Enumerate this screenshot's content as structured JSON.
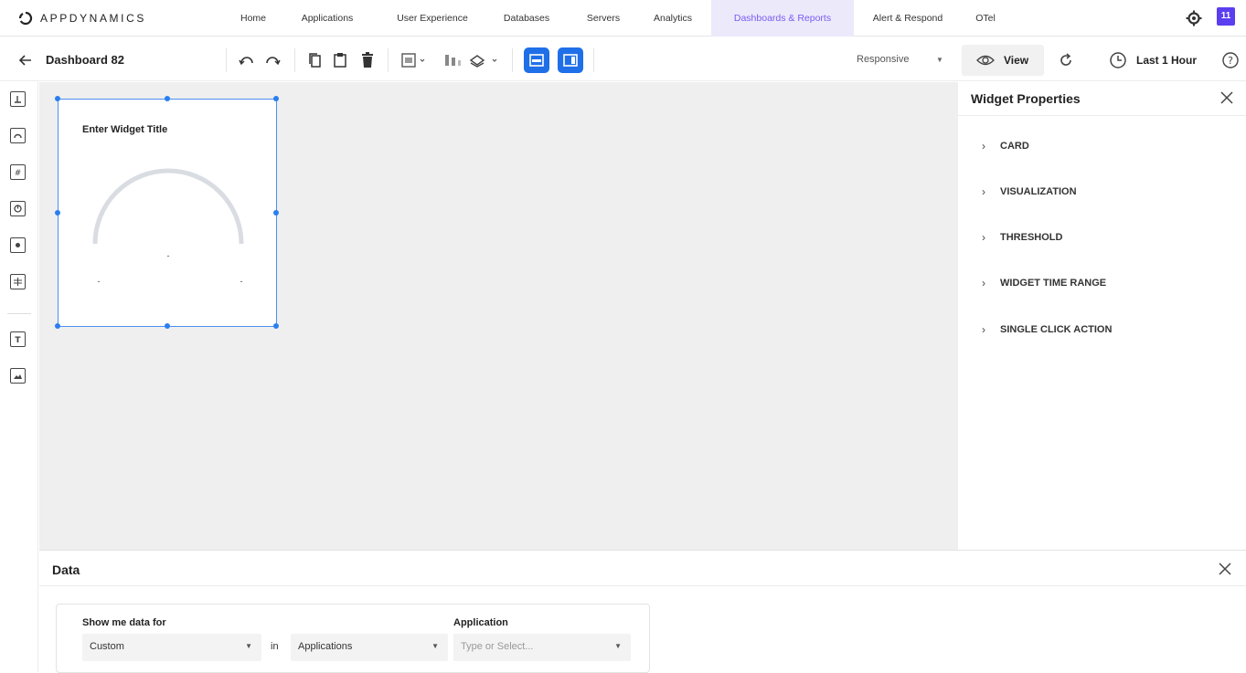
{
  "app": {
    "logo_text": "APPDYNAMICS",
    "nav": [
      "Home",
      "Applications",
      "User Experience",
      "Databases",
      "Servers",
      "Analytics",
      "Dashboards & Reports",
      "Alert & Respond",
      "OTel"
    ],
    "active_nav": "Dashboards & Reports",
    "user_badge": "11",
    "accent_color": "#7b5cf0"
  },
  "toolbar": {
    "dashboard_title": "Dashboard 82",
    "layout_mode": "Responsive",
    "view_label": "View",
    "time_range": "Last 1 Hour",
    "toggle_color": "#1f6fe8"
  },
  "widget": {
    "title": "Enter Widget Title",
    "gauge_center_value": "-",
    "gauge_min_label": "-",
    "gauge_max_label": "-"
  },
  "widget_properties": {
    "title": "Widget Properties",
    "sections": [
      "CARD",
      "VISUALIZATION",
      "THRESHOLD",
      "WIDGET TIME RANGE",
      "SINGLE CLICK ACTION"
    ]
  },
  "data_panel": {
    "title": "Data",
    "show_me_label": "Show me data for",
    "show_me_value": "Custom",
    "in_label": "in",
    "scope_value": "Applications",
    "application_label": "Application",
    "application_placeholder": "Type or Select..."
  }
}
